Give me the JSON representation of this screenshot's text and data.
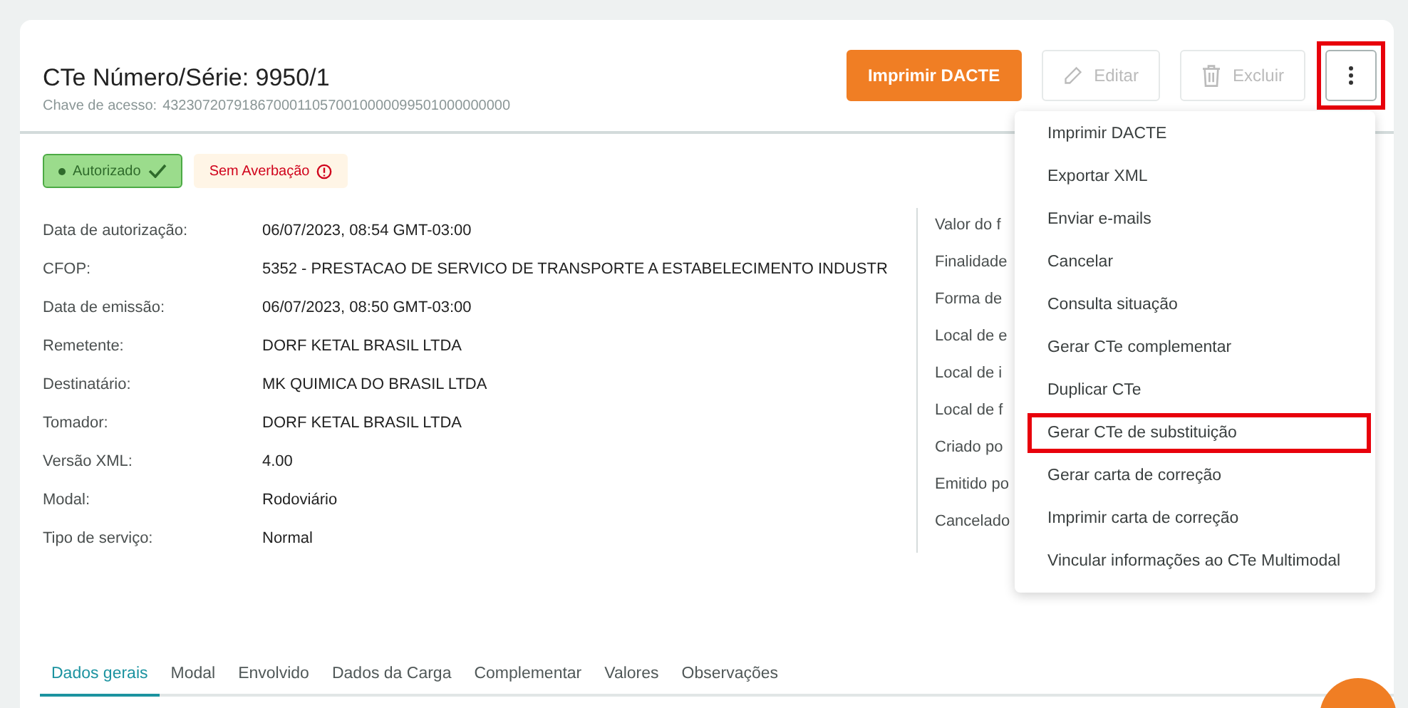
{
  "header": {
    "title": "CTe Número/Série: 9950/1",
    "access_key_label": "Chave de acesso:",
    "access_key": "43230720791867000110570010000099501000000000"
  },
  "actions": [
    {
      "kind": "primary",
      "label": "Imprimir DACTE",
      "disabled": false
    },
    {
      "kind": "edit",
      "label": "Editar",
      "disabled": true
    },
    {
      "kind": "delete",
      "label": "Excluir",
      "disabled": true
    }
  ],
  "more_button": {
    "expanded": true,
    "highlighted": true
  },
  "badges": [
    {
      "kind": "success",
      "label": "Autorizado"
    },
    {
      "kind": "warning",
      "label": "Sem Averbação"
    }
  ],
  "details": [
    {
      "label": "Data de autorização:",
      "value": "06/07/2023, 08:54 GMT-03:00"
    },
    {
      "label": "CFOP:",
      "value": "5352 - PRESTACAO DE SERVICO DE TRANSPORTE A ESTABELECIMENTO INDUSTR"
    },
    {
      "label": "Data de emissão:",
      "value": "06/07/2023, 08:50 GMT-03:00"
    },
    {
      "label": "Remetente:",
      "value": "DORF KETAL BRASIL LTDA"
    },
    {
      "label": "Destinatário:",
      "value": "MK QUIMICA DO BRASIL LTDA"
    },
    {
      "label": "Tomador:",
      "value": "DORF KETAL BRASIL LTDA"
    },
    {
      "label": "Versão XML:",
      "value": "4.00"
    },
    {
      "label": "Modal:",
      "value": "Rodoviário"
    },
    {
      "label": "Tipo de serviço:",
      "value": "Normal"
    }
  ],
  "details_right": [
    "Valor do f",
    "Finalidade",
    "Forma de",
    "Local de e",
    "Local de i",
    "Local de f",
    "Criado po",
    "Emitido po",
    "Cancelado"
  ],
  "menu": [
    {
      "label": "Imprimir DACTE",
      "highlighted": false
    },
    {
      "label": "Exportar XML",
      "highlighted": false
    },
    {
      "label": "Enviar e-mails",
      "highlighted": false
    },
    {
      "label": "Cancelar",
      "highlighted": false
    },
    {
      "label": "Consulta situação",
      "highlighted": false
    },
    {
      "label": "Gerar CTe complementar",
      "highlighted": false
    },
    {
      "label": "Duplicar CTe",
      "highlighted": false
    },
    {
      "label": "Gerar CTe de substituição",
      "highlighted": true
    },
    {
      "label": "Gerar carta de correção",
      "highlighted": false
    },
    {
      "label": "Imprimir carta de correção",
      "highlighted": false
    },
    {
      "label": "Vincular informações ao CTe Multimodal",
      "highlighted": false
    }
  ],
  "tabs": [
    {
      "label": "Dados gerais",
      "selected": true
    },
    {
      "label": "Modal",
      "selected": false
    },
    {
      "label": "Envolvido",
      "selected": false
    },
    {
      "label": "Dados da Carga",
      "selected": false
    },
    {
      "label": "Complementar",
      "selected": false
    },
    {
      "label": "Valores",
      "selected": false
    },
    {
      "label": "Observações",
      "selected": false
    }
  ]
}
